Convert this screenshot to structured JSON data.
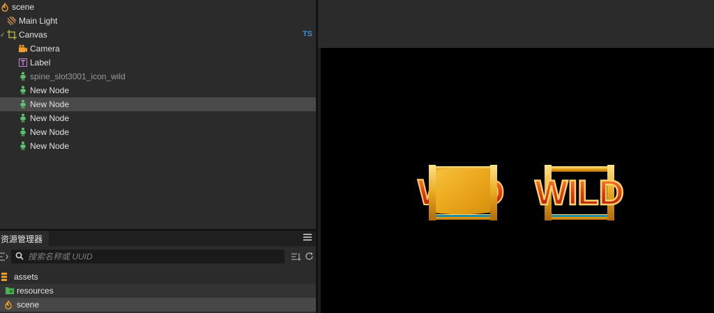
{
  "hierarchy": {
    "script_tag": "TS",
    "nodes": [
      {
        "label": "scene",
        "icon": "scene-icon"
      },
      {
        "label": "Main Light",
        "icon": "light-icon"
      },
      {
        "label": "Canvas",
        "icon": "canvas-icon"
      },
      {
        "label": "Camera",
        "icon": "camera-icon"
      },
      {
        "label": "Label",
        "icon": "label-icon"
      },
      {
        "label": "spine_slot3001_icon_wild",
        "icon": "spine-icon"
      },
      {
        "label": "New Node",
        "icon": "spine-icon"
      },
      {
        "label": "New Node",
        "icon": "spine-icon",
        "selected": true
      },
      {
        "label": "New Node",
        "icon": "spine-icon"
      },
      {
        "label": "New Node",
        "icon": "spine-icon"
      },
      {
        "label": "New Node",
        "icon": "spine-icon"
      }
    ]
  },
  "assets": {
    "tab_label": "资源管理器",
    "search_placeholder": "搜索名称或 UUID",
    "items": [
      {
        "label": "assets",
        "icon": "database-icon"
      },
      {
        "label": "resources",
        "icon": "folder-icon"
      },
      {
        "label": "scene",
        "icon": "scene-icon",
        "selected": true
      }
    ]
  },
  "scene_view": {
    "sprites": [
      {
        "text": "W",
        "text_end": "D",
        "style": "covered-by-parchment-panel"
      },
      {
        "text": "WILD",
        "style": "golden-frame"
      }
    ]
  },
  "colors": {
    "panel_bg": "#2b2b2b",
    "selected_row": "#4a4a4a",
    "accent_ts": "#3d8fd8",
    "spine_green": "#5cc46d",
    "camera_orange": "#f0a02a",
    "viewport_bg": "#000000"
  }
}
